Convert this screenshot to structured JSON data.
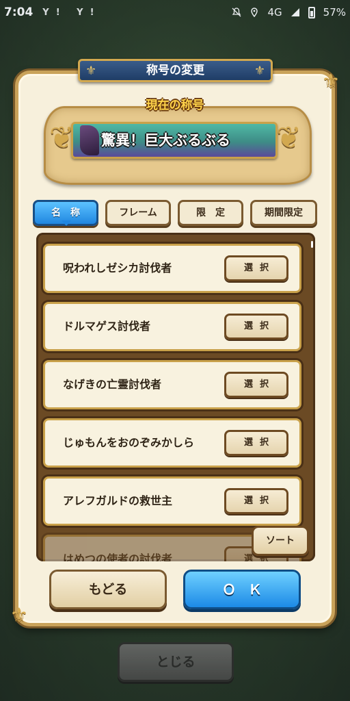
{
  "status_bar": {
    "time": "7:04",
    "left_icons": "Y! Y!",
    "network": "4G",
    "battery": "57%"
  },
  "dialog": {
    "title": "称号の変更",
    "current_label": "現在の称号",
    "current_title": "驚異！巨大ぶるぶる"
  },
  "tabs": [
    {
      "label": "名　称"
    },
    {
      "label": "フレーム"
    },
    {
      "label": "限　定"
    },
    {
      "label": "期間限定"
    }
  ],
  "titles": [
    {
      "name": "呪われしゼシカ討伐者",
      "button": "選択"
    },
    {
      "name": "ドルマゲス討伐者",
      "button": "選択"
    },
    {
      "name": "なげきの亡霊討伐者",
      "button": "選択"
    },
    {
      "name": "じゅもんをおのぞみかしら",
      "button": "選択"
    },
    {
      "name": "アレフガルドの救世主",
      "button": "選択"
    },
    {
      "name": "はめつの使者の討伐者",
      "button": "選択"
    }
  ],
  "buttons": {
    "sort": "ソート",
    "back": "もどる",
    "ok": "ＯＫ",
    "close": "とじる"
  }
}
